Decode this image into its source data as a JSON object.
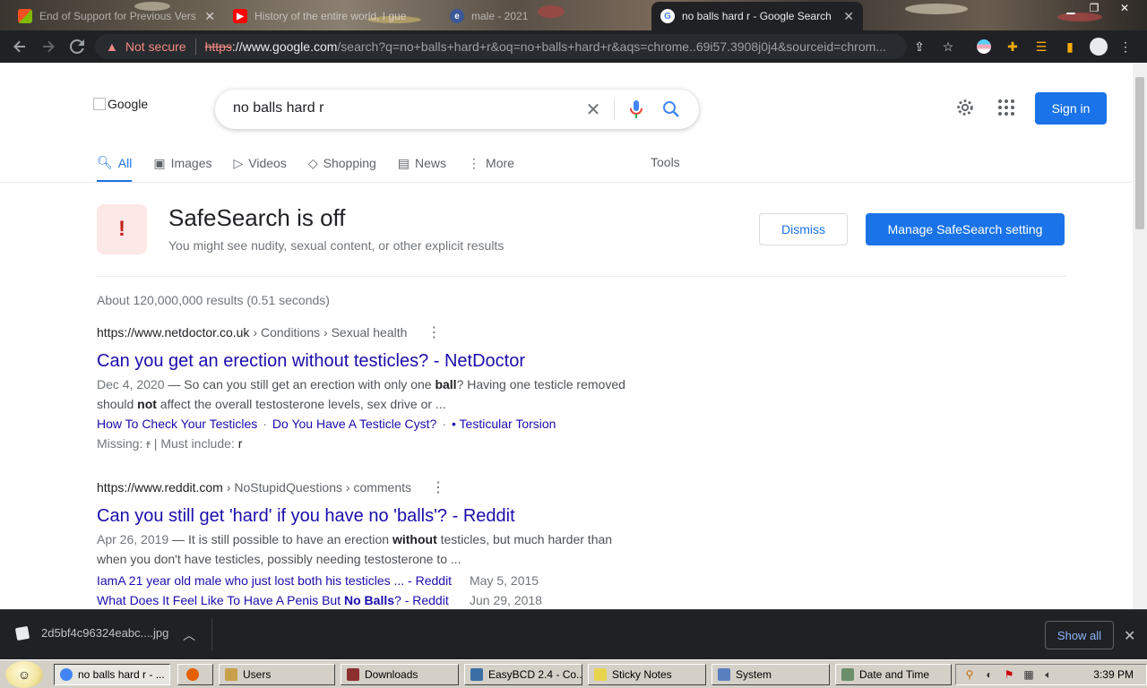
{
  "browser": {
    "tabs": [
      {
        "label": "End of Support for Previous Vers"
      },
      {
        "label": "History of the entire world, I gue"
      },
      {
        "label": "male - 2021"
      },
      {
        "label": "no balls hard r - Google Search"
      }
    ],
    "omnibox": {
      "security": "Not secure",
      "scheme": "https",
      "host": "://www.google.com",
      "path": "/search?q=no+balls+hard+r&oq=no+balls+hard+r&aqs=chrome..69i57.3908j0j4&sourceid=chrom..."
    }
  },
  "google": {
    "logo_alt": "Google",
    "query": "no balls hard r",
    "sign_in": "Sign in",
    "tabs": [
      {
        "label": "All",
        "icon": "search-icon"
      },
      {
        "label": "Images",
        "icon": "image-icon"
      },
      {
        "label": "Videos",
        "icon": "video-icon"
      },
      {
        "label": "Shopping",
        "icon": "tag-icon"
      },
      {
        "label": "News",
        "icon": "news-icon"
      },
      {
        "label": "More",
        "icon": "more-icon"
      }
    ],
    "tools": "Tools",
    "safesearch": {
      "icon_glyph": "!",
      "title": "SafeSearch is off",
      "subtitle": "You might see nudity, sexual content, or other explicit results",
      "dismiss": "Dismiss",
      "manage": "Manage SafeSearch setting"
    },
    "stats": "About 120,000,000 results (0.51 seconds)",
    "results": [
      {
        "cite_host": "https://www.netdoctor.co.uk",
        "cite_path": "› Conditions › Sexual health",
        "title": "Can you get an erection without testicles? - NetDoctor",
        "date": "Dec 4, 2020",
        "snippet_a": " — So can you still get an erection with only one ",
        "snippet_b1": "ball",
        "snippet_c": "? Having one testicle removed should ",
        "snippet_b2": "not",
        "snippet_d": " affect the overall testosterone levels, sex drive or ...",
        "links": [
          "How To Check Your Testicles",
          "Do You Have A Testicle Cyst?",
          "• Testicular Torsion"
        ],
        "link_sep": "·",
        "missing_label": "Missing: ",
        "missing_term": "r",
        "must_label": " | Must include: ",
        "must_term": "r"
      },
      {
        "cite_host": "https://www.reddit.com",
        "cite_path": "› NoStupidQuestions › comments",
        "title": "Can you still get 'hard' if you have no 'balls'? - Reddit",
        "date": "Apr 26, 2019",
        "snippet_a": " — It is still possible to have an erection ",
        "snippet_b1": "without",
        "snippet_c": " testicles, but much harder than when you don't have testicles, possibly needing testosterone to ...",
        "subresults": [
          {
            "text_a": "IamA 21 year old male who just lost both his testicles ... - Reddit",
            "bold": "",
            "text_b": "",
            "date": "May 5, 2015"
          },
          {
            "text_a": "What Does It Feel Like To Have A Penis But ",
            "bold": "No Balls",
            "text_b": "? - Reddit",
            "date": "Jun 29, 2018"
          }
        ]
      }
    ]
  },
  "download_bar": {
    "file": "2d5bf4c96324eabc....jpg",
    "show_all": "Show all"
  },
  "taskbar": {
    "tasks": [
      {
        "label": "no balls hard r - ...",
        "color": "#4285f4"
      },
      {
        "label": "",
        "color": "#e66000"
      },
      {
        "label": "Users",
        "color": "#c8a04a"
      },
      {
        "label": "Downloads",
        "color": "#8b2f2f"
      },
      {
        "label": "EasyBCD 2.4 - Co...",
        "color": "#3a6ea5"
      },
      {
        "label": "Sticky Notes",
        "color": "#e8d44d"
      },
      {
        "label": "System",
        "color": "#5a7fbf"
      },
      {
        "label": "Date and Time",
        "color": "#6a8f6a"
      }
    ],
    "clock": "3:39 PM"
  },
  "colors": {
    "accent": "#1a73e8",
    "link": "#1a0dab",
    "warning": "#c5221f"
  }
}
